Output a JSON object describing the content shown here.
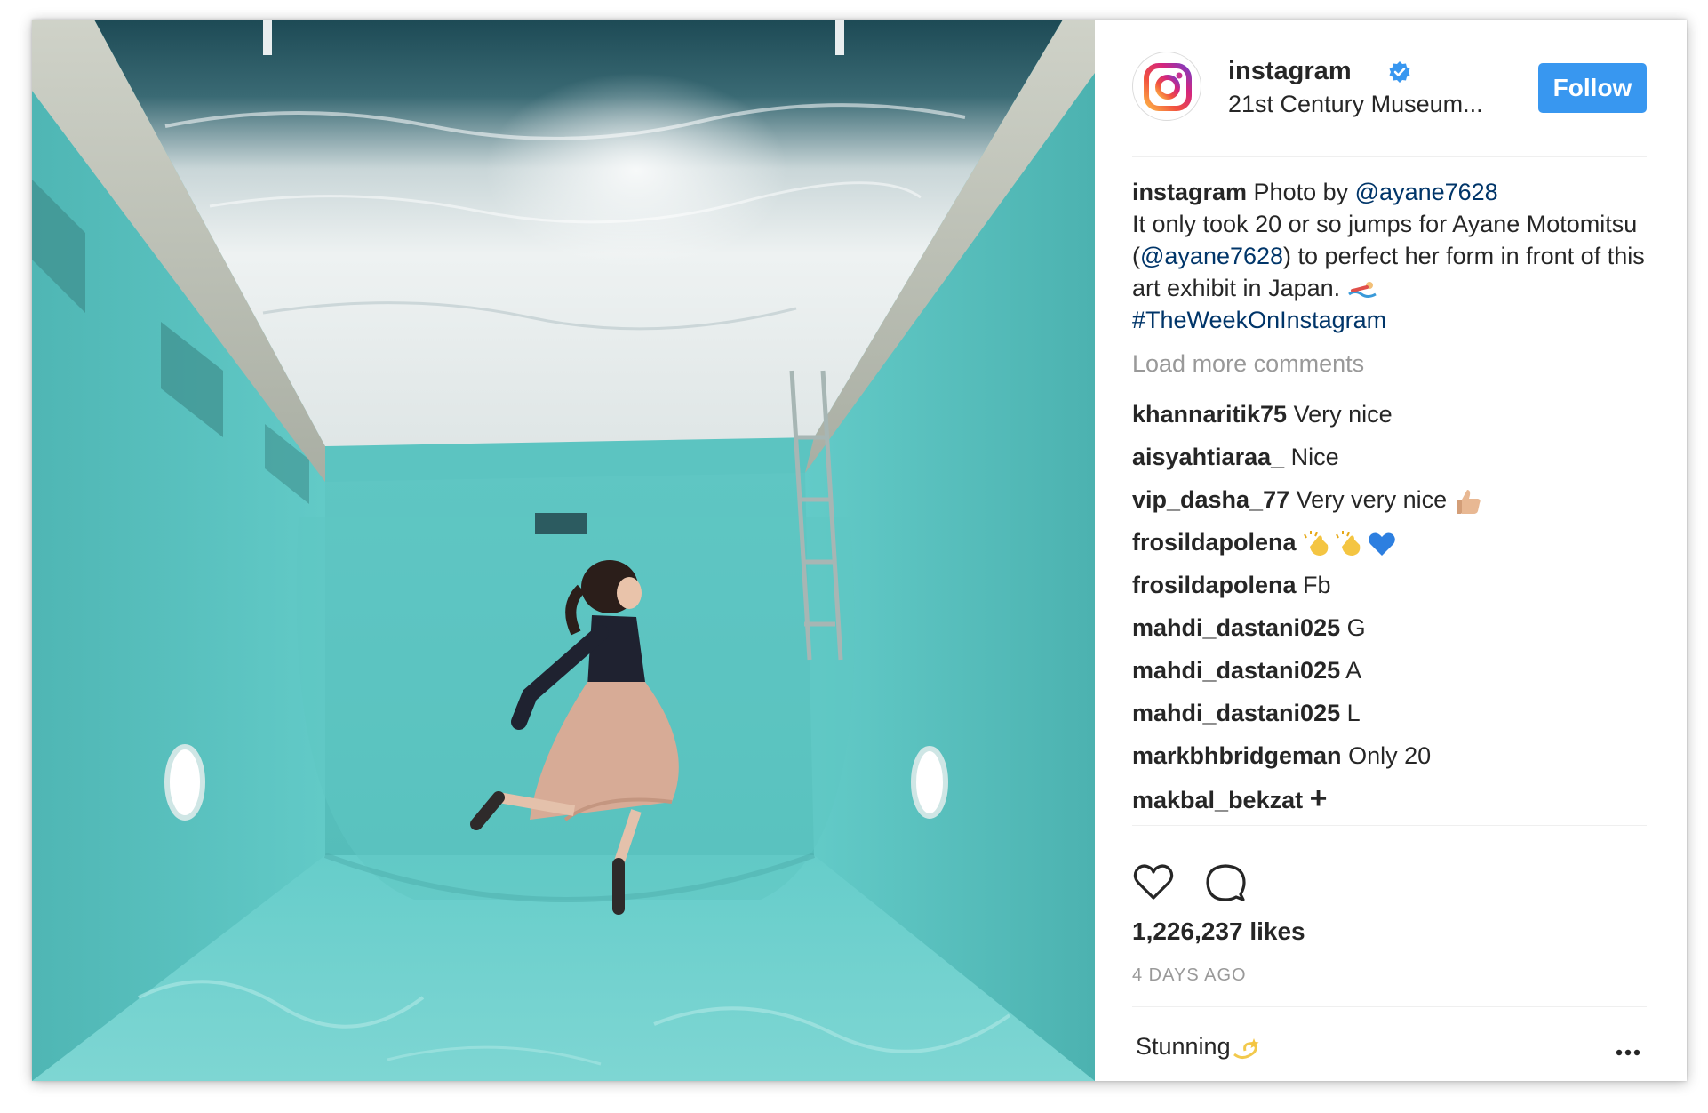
{
  "post": {
    "account": {
      "username": "instagram",
      "verified": true,
      "location": "21st Century Museum...",
      "follow_label": "Follow"
    },
    "caption": {
      "username": "instagram",
      "text_1": " Photo by ",
      "mention_1": "@ayane7628",
      "text_2": "It only took 20 or so jumps for Ayane Motomitsu (",
      "mention_2": "@ayane7628",
      "text_3": ") to perfect her form in front of this art exhibit in Japan. ",
      "hashtag": "#TheWeekOnInstagram"
    },
    "load_more_label": "Load more comments",
    "comments": [
      {
        "user": "khannaritik75",
        "text": "Very nice"
      },
      {
        "user": "aisyahtiaraa_",
        "text": "Nice"
      },
      {
        "user": "vip_dasha_77",
        "text": "Very very nice"
      },
      {
        "user": "frosildapolena",
        "text": ""
      },
      {
        "user": "frosildapolena",
        "text": "Fb"
      },
      {
        "user": "mahdi_dastani025",
        "text": "G"
      },
      {
        "user": "mahdi_dastani025",
        "text": "A"
      },
      {
        "user": "mahdi_dastani025",
        "text": "L"
      },
      {
        "user": "markbhbridgeman",
        "text": "Only 20"
      },
      {
        "user": "makbal_bekzat",
        "text": "+"
      }
    ],
    "likes": "1,226,237 likes",
    "time_ago": "4 DAYS AGO",
    "comment_input_value": "Stunning",
    "icons": {
      "like": "heart-icon",
      "comment": "comment-bubble-icon",
      "more": "more-options-icon",
      "verified": "verified-badge-icon"
    },
    "colors": {
      "follow_button": "#3897f0",
      "link": "#003569",
      "muted": "#999999",
      "pool": "#58c8c6"
    }
  }
}
